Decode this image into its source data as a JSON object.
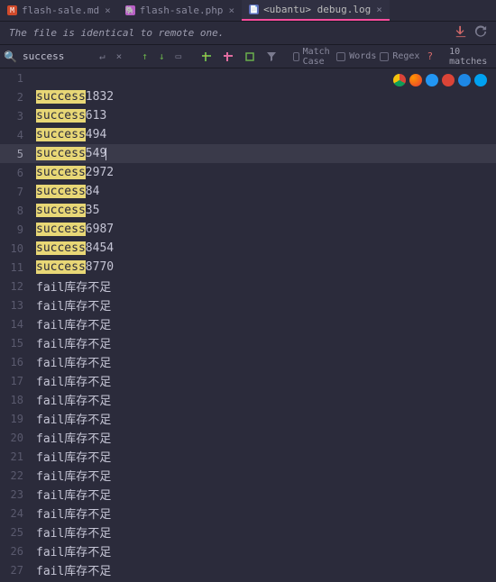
{
  "tabs": [
    {
      "label": "flash-sale.md",
      "active": false
    },
    {
      "label": "flash-sale.php",
      "active": false
    },
    {
      "label": "<ubantu> debug.log",
      "active": true
    }
  ],
  "status": {
    "message": "The file is identical to remote one."
  },
  "find": {
    "query": "success",
    "match_case_label": "Match Case",
    "words_label": "Words",
    "regex_label": "Regex",
    "count_label": "10 matches",
    "question": "?"
  },
  "editor": {
    "current_line": 5,
    "lines": [
      {
        "n": 1,
        "match": "",
        "rest": ""
      },
      {
        "n": 2,
        "match": "success",
        "rest": "1832"
      },
      {
        "n": 3,
        "match": "success",
        "rest": "613"
      },
      {
        "n": 4,
        "match": "success",
        "rest": "494"
      },
      {
        "n": 5,
        "match": "success",
        "rest": "549"
      },
      {
        "n": 6,
        "match": "success",
        "rest": "2972"
      },
      {
        "n": 7,
        "match": "success",
        "rest": "84"
      },
      {
        "n": 8,
        "match": "success",
        "rest": "35"
      },
      {
        "n": 9,
        "match": "success",
        "rest": "6987"
      },
      {
        "n": 10,
        "match": "success",
        "rest": "8454"
      },
      {
        "n": 11,
        "match": "success",
        "rest": "8770"
      },
      {
        "n": 12,
        "match": "",
        "rest": "fail库存不足"
      },
      {
        "n": 13,
        "match": "",
        "rest": "fail库存不足"
      },
      {
        "n": 14,
        "match": "",
        "rest": "fail库存不足"
      },
      {
        "n": 15,
        "match": "",
        "rest": "fail库存不足"
      },
      {
        "n": 16,
        "match": "",
        "rest": "fail库存不足"
      },
      {
        "n": 17,
        "match": "",
        "rest": "fail库存不足"
      },
      {
        "n": 18,
        "match": "",
        "rest": "fail库存不足"
      },
      {
        "n": 19,
        "match": "",
        "rest": "fail库存不足"
      },
      {
        "n": 20,
        "match": "",
        "rest": "fail库存不足"
      },
      {
        "n": 21,
        "match": "",
        "rest": "fail库存不足"
      },
      {
        "n": 22,
        "match": "",
        "rest": "fail库存不足"
      },
      {
        "n": 23,
        "match": "",
        "rest": "fail库存不足"
      },
      {
        "n": 24,
        "match": "",
        "rest": "fail库存不足"
      },
      {
        "n": 25,
        "match": "",
        "rest": "fail库存不足"
      },
      {
        "n": 26,
        "match": "",
        "rest": "fail库存不足"
      },
      {
        "n": 27,
        "match": "",
        "rest": "fail库存不足"
      }
    ]
  },
  "browser_icons": {
    "colors": [
      "#f4c20d",
      "#ff5722",
      "#2296f3",
      "#db4437",
      "#1e88e5",
      "#00a1f1"
    ]
  }
}
